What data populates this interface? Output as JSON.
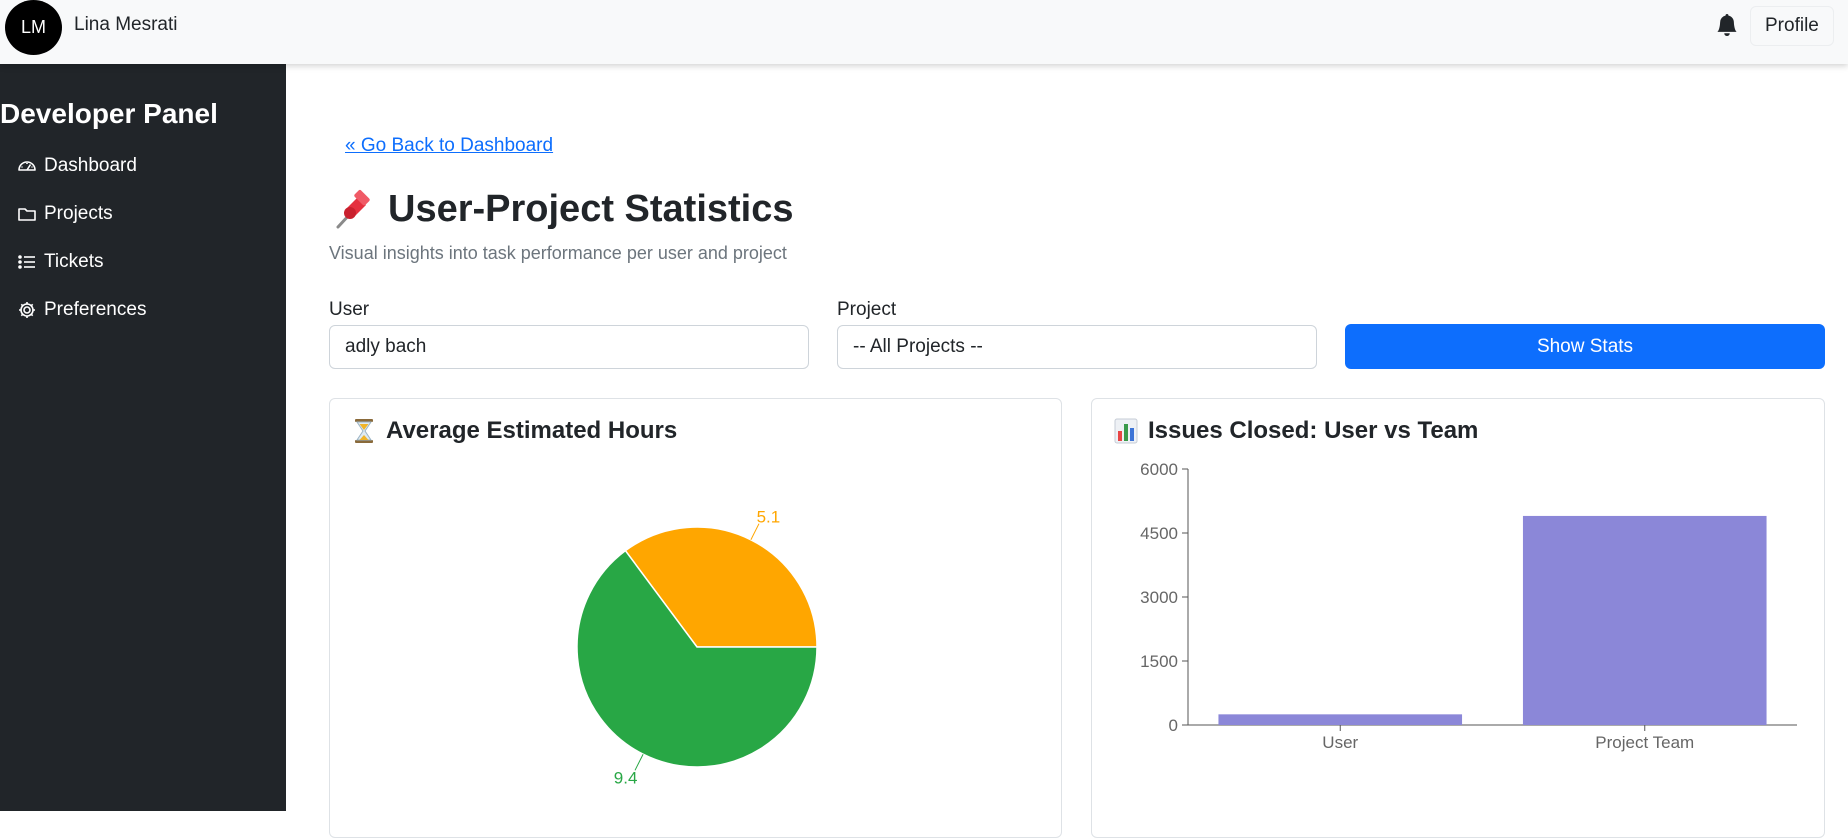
{
  "header": {
    "avatar_initials": "LM",
    "user_name": "Lina Mesrati",
    "profile_label": "Profile"
  },
  "sidebar": {
    "title": "Developer Panel",
    "items": [
      {
        "label": "Dashboard",
        "icon": "speedometer-icon"
      },
      {
        "label": "Projects",
        "icon": "folder-icon"
      },
      {
        "label": "Tickets",
        "icon": "list-icon"
      },
      {
        "label": "Preferences",
        "icon": "gear-icon"
      }
    ]
  },
  "main": {
    "back_link": "« Go Back to Dashboard",
    "title": "User-Project Statistics",
    "subtitle": "Visual insights into task performance per user and project",
    "filters": {
      "user_label": "User",
      "user_value": "adly bach",
      "project_label": "Project",
      "project_value": "-- All Projects --",
      "submit_label": "Show Stats"
    }
  },
  "cards": {
    "hours_title": "Average Estimated Hours",
    "issues_title": "Issues Closed: User vs Team"
  },
  "colors": {
    "accent": "#0d6efd",
    "sidebar_bg": "#212529",
    "pie_orange": "#ffa600",
    "pie_green": "#28a745",
    "bar": "#8b87d8"
  },
  "chart_data": [
    {
      "type": "pie",
      "title": "Average Estimated Hours",
      "slices": [
        {
          "value": 5.1,
          "label": "5.1",
          "color": "#ffa600"
        },
        {
          "value": 9.4,
          "label": "9.4",
          "color": "#28a745"
        }
      ]
    },
    {
      "type": "bar",
      "title": "Issues Closed: User vs Team",
      "categories": [
        "User",
        "Project Team"
      ],
      "values": [
        250,
        4900
      ],
      "ylim": [
        0,
        6000
      ],
      "yticks": [
        0,
        1500,
        3000,
        4500,
        6000
      ],
      "color": "#8b87d8"
    }
  ]
}
